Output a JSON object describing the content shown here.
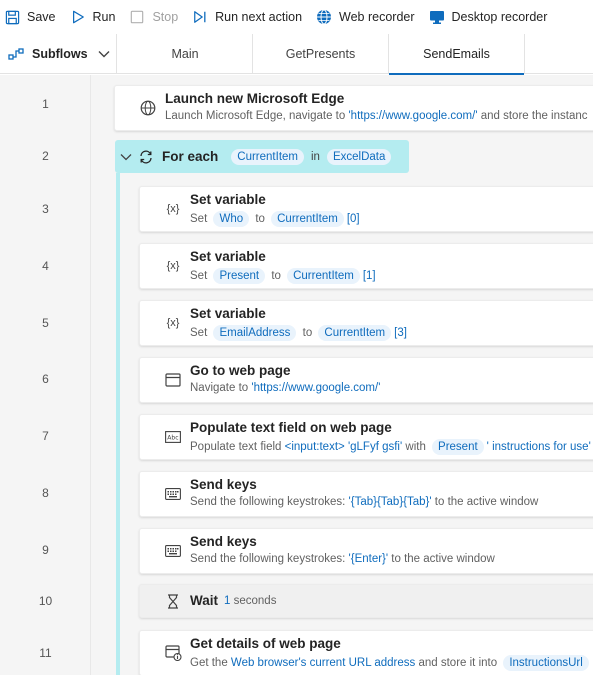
{
  "toolbar": {
    "save": "Save",
    "run": "Run",
    "stop": "Stop",
    "run_next": "Run next action",
    "web_recorder": "Web recorder",
    "desktop_recorder": "Desktop recorder"
  },
  "tabs": {
    "subflows": "Subflows",
    "items": [
      "Main",
      "GetPresents",
      "SendEmails"
    ],
    "active": "SendEmails"
  },
  "line_numbers": [
    "1",
    "2",
    "3",
    "4",
    "5",
    "6",
    "7",
    "8",
    "9",
    "10",
    "11"
  ],
  "actions": {
    "a1": {
      "title": "Launch new Microsoft Edge",
      "d1": "Launch Microsoft Edge, navigate to ",
      "url": "'https://www.google.com/'",
      "d2": " and store the instanc"
    },
    "a2": {
      "title": "For each",
      "item": "CurrentItem",
      "in": "in",
      "list": "ExcelData"
    },
    "a3": {
      "title": "Set variable",
      "set": "Set",
      "var": "Who",
      "to": "to",
      "val": "CurrentItem",
      "idx": "[0]"
    },
    "a4": {
      "title": "Set variable",
      "set": "Set",
      "var": "Present",
      "to": "to",
      "val": "CurrentItem",
      "idx": "[1]"
    },
    "a5": {
      "title": "Set variable",
      "set": "Set",
      "var": "EmailAddress",
      "to": "to",
      "val": "CurrentItem",
      "idx": "[3]"
    },
    "a6": {
      "title": "Go to web page",
      "d1": "Navigate to ",
      "url": "'https://www.google.com/'"
    },
    "a7": {
      "title": "Populate text field on web page",
      "d1": "Populate text field ",
      "el": "<input:text>",
      "el2": "'gLFyf gsfi'",
      "with": " with ",
      "var": "Present",
      "rest": "' instructions for use'"
    },
    "a8": {
      "title": "Send keys",
      "d1": "Send the following keystrokes: ",
      "keys": "'{Tab}{Tab}{Tab}'",
      "d2": " to the active window"
    },
    "a9": {
      "title": "Send keys",
      "d1": "Send the following keystrokes: ",
      "keys": "'{Enter}'",
      "d2": " to the active window"
    },
    "a10": {
      "title": "Wait",
      "num": "1",
      "unit": "seconds"
    },
    "a11": {
      "title": "Get details of web page",
      "d1": "Get the ",
      "link": "Web browser's current URL address",
      "d2": " and store it into ",
      "var": "InstructionsUrl"
    }
  },
  "colors": {
    "accent": "#0f6cbd",
    "loop": "#b4ecf0"
  }
}
